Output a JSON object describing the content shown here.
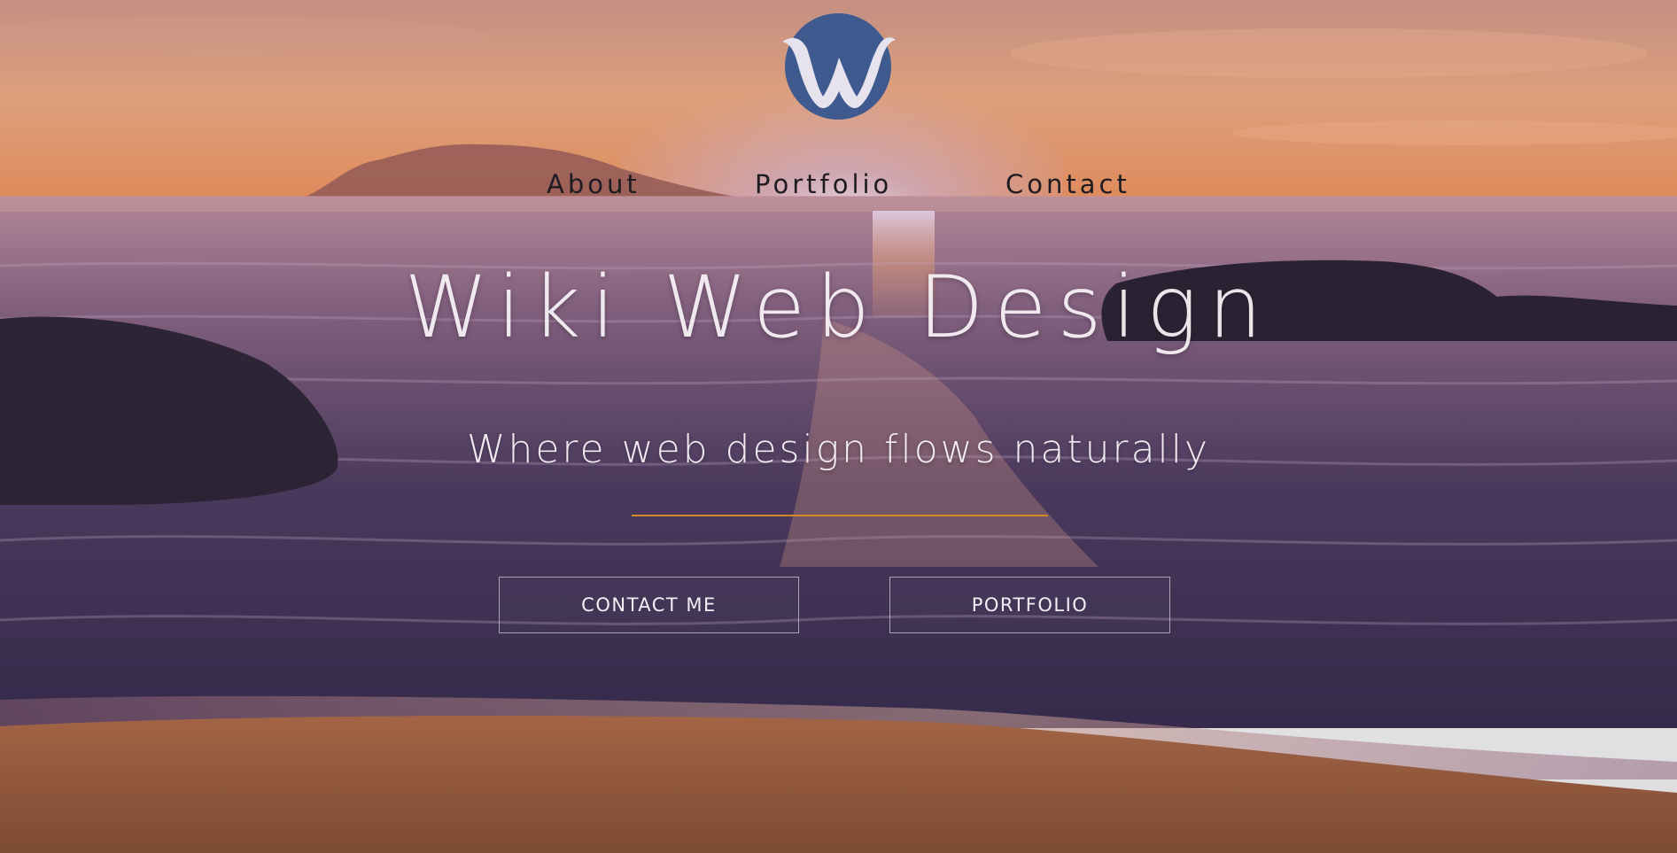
{
  "brand": {
    "logo_letter": "W",
    "logo_color": "#3e5a8e"
  },
  "nav": {
    "items": [
      {
        "label": "About"
      },
      {
        "label": "Portfolio"
      },
      {
        "label": "Contact"
      }
    ]
  },
  "hero": {
    "title": "Wiki Web Design",
    "tagline": "Where web design flows naturally",
    "divider_color": "#d08a2a",
    "buttons": {
      "contact_label": "CONTACT ME",
      "portfolio_label": "PORTFOLIO"
    }
  },
  "icons": {
    "logo": "wave-w-logo-icon"
  }
}
